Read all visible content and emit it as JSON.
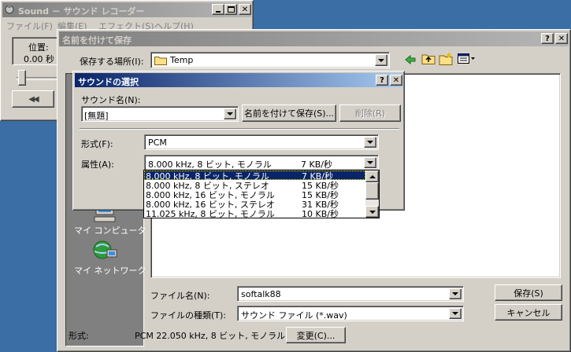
{
  "sound_window": {
    "title": "Sound － サウンド レコーダー",
    "menu": [
      "ファイル(F)",
      "編集(E)",
      "エフェクト(S)",
      "ヘルプ(H)"
    ],
    "position_label": "位置:",
    "position_value": "0.00 秒",
    "rewind_symbol": "◀◀"
  },
  "save_dialog": {
    "title": "名前を付けて保存",
    "save_in_label": "保存する場所(I):",
    "save_in_value": "Temp",
    "places": [
      {
        "label": "マイ コンピュータ",
        "icon": "my-computer-icon"
      },
      {
        "label": "マイ ネットワーク",
        "icon": "my-network-icon"
      }
    ],
    "filename_label": "ファイル名(N):",
    "filename_value": "softalk88",
    "filetype_label": "ファイルの種類(T):",
    "filetype_value": "サウンド ファイル (*.wav)",
    "save_button": "保存(S)",
    "cancel_button": "キャンセル",
    "format_label": "形式:",
    "format_value": "PCM 22.050 kHz, 8 ビット, モノラル",
    "change_button": "変更(C)..."
  },
  "sound_select": {
    "title": "サウンドの選択",
    "name_label": "サウンド名(N):",
    "name_value": "[無題]",
    "save_as_button": "名前を付けて保存(S)...",
    "delete_button": "削除(R)",
    "format_label": "形式(F):",
    "format_value": "PCM",
    "attributes_label": "属性(A):",
    "attributes_value": {
      "spec": "8.000 kHz, 8 ビット, モノラル",
      "rate": "7 KB/秒"
    },
    "attributes_list": [
      {
        "spec": "8.000 kHz, 8 ビット, モノラル",
        "rate": "7 KB/秒",
        "selected": true
      },
      {
        "spec": "8.000 kHz, 8 ビット, ステレオ",
        "rate": "15 KB/秒",
        "selected": false
      },
      {
        "spec": "8.000 kHz, 16 ビット, モノラル",
        "rate": "15 KB/秒",
        "selected": false
      },
      {
        "spec": "8.000 kHz, 16 ビット, ステレオ",
        "rate": "31 KB/秒",
        "selected": false
      },
      {
        "spec": "11.025 kHz, 8 ビット, モノラル",
        "rate": "10 KB/秒",
        "selected": false
      }
    ]
  },
  "colors": {
    "desktop": "#3a6ea5",
    "face": "#d4d0c8",
    "selection": "#0a246a",
    "places_bar": "#808080"
  }
}
